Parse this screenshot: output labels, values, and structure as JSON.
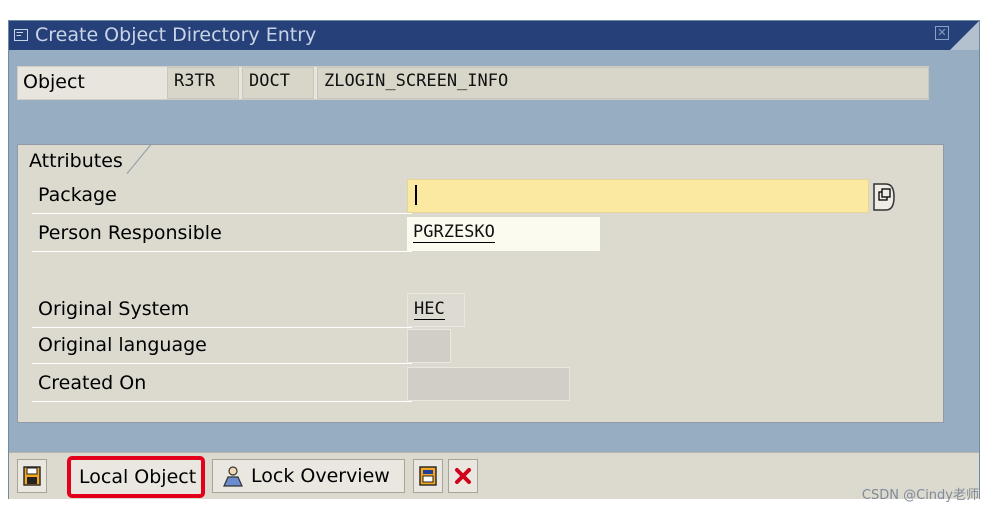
{
  "window": {
    "title": "Create Object Directory Entry"
  },
  "object_row": {
    "label": "Object",
    "pgmid": "R3TR",
    "type": "DOCT",
    "name": "ZLOGIN_SCREEN_INFO"
  },
  "attributes": {
    "group_title": "Attributes",
    "package": {
      "label": "Package",
      "value": ""
    },
    "person_responsible": {
      "label": "Person Responsible",
      "value": "PGRZESKO"
    },
    "original_system": {
      "label": "Original System",
      "value": "HEC"
    },
    "original_language": {
      "label": "Original language",
      "value": ""
    },
    "created_on": {
      "label": "Created On",
      "value": ""
    }
  },
  "toolbar": {
    "local_object_label": "Local Object",
    "lock_overview_label": "Lock Overview"
  },
  "watermark": "CSDN @Cindy老师",
  "colors": {
    "title_bar": "#26407a",
    "window_bg": "#97adc1",
    "required_field": "#fce9a1",
    "highlight": "#e3001b"
  },
  "icons": [
    "window-menu-icon",
    "close-icon",
    "value-help-icon",
    "save-icon",
    "lock-overview-icon",
    "tree-icon",
    "cancel-icon"
  ]
}
